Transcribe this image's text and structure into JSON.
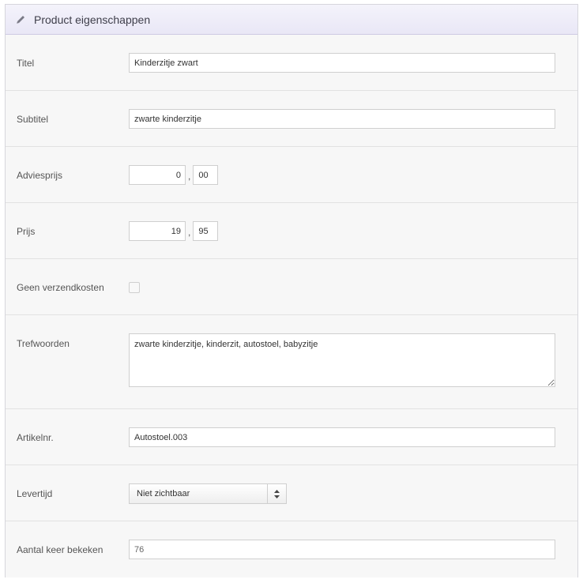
{
  "header": {
    "title": "Product eigenschappen",
    "icon": "pencil-icon"
  },
  "fields": {
    "titel": {
      "label": "Titel",
      "value": "Kinderzitje zwart"
    },
    "subtitel": {
      "label": "Subtitel",
      "value": "zwarte kinderzitje"
    },
    "adviesprijs": {
      "label": "Adviesprijs",
      "whole": "0",
      "separator": ",",
      "cents": "00"
    },
    "prijs": {
      "label": "Prijs",
      "whole": "19",
      "separator": ",",
      "cents": "95"
    },
    "geen_verzendkosten": {
      "label": "Geen verzendkosten",
      "checked": false
    },
    "trefwoorden": {
      "label": "Trefwoorden",
      "value": "zwarte kinderzitje, kinderzit, autostoel, babyzitje"
    },
    "artikelnr": {
      "label": "Artikelnr.",
      "value": "Autostoel.003"
    },
    "levertijd": {
      "label": "Levertijd",
      "selected": "Niet zichtbaar"
    },
    "aantal_keer_bekeken": {
      "label": "Aantal keer bekeken",
      "value": "76"
    }
  }
}
